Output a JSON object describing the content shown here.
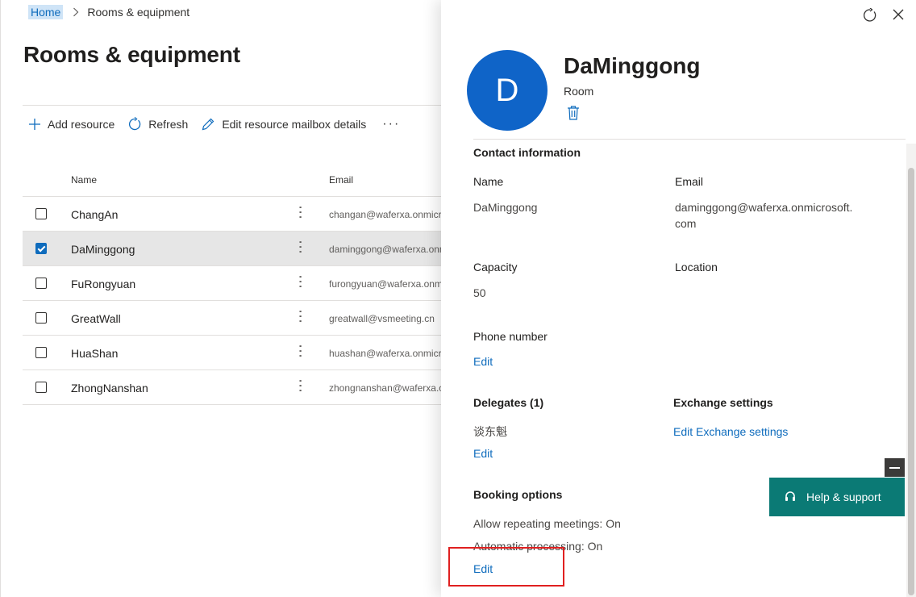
{
  "breadcrumb": {
    "home": "Home",
    "current": "Rooms & equipment"
  },
  "page": {
    "title": "Rooms & equipment"
  },
  "toolbar": {
    "add_label": "Add resource",
    "refresh_label": "Refresh",
    "edit_label": "Edit resource mailbox details",
    "more_label": "···"
  },
  "table": {
    "columns": {
      "name": "Name",
      "email": "Email"
    },
    "rows": [
      {
        "name": "ChangAn",
        "email": "changan@waferxa.onmicrosoft.com",
        "selected": false
      },
      {
        "name": "DaMinggong",
        "email": "daminggong@waferxa.onmicrosoft.com",
        "selected": true
      },
      {
        "name": "FuRongyuan",
        "email": "furongyuan@waferxa.onmicrosoft.com",
        "selected": false
      },
      {
        "name": "GreatWall",
        "email": "greatwall@vsmeeting.cn",
        "selected": false
      },
      {
        "name": "HuaShan",
        "email": "huashan@waferxa.onmicrosoft.com",
        "selected": false
      },
      {
        "name": "ZhongNanshan",
        "email": "zhongnanshan@waferxa.onmicrosoft.com",
        "selected": false
      }
    ]
  },
  "panel": {
    "avatar_letter": "D",
    "name": "DaMinggong",
    "type": "Room",
    "contact_title": "Contact information",
    "name_label": "Name",
    "name_value": "DaMinggong",
    "email_label": "Email",
    "email_value_line1": "daminggong@waferxa.onmicrosoft.",
    "email_value_line2": "com",
    "capacity_label": "Capacity",
    "capacity_value": "50",
    "location_label": "Location",
    "phone_label": "Phone number",
    "phone_edit": "Edit",
    "delegates_label": "Delegates (1)",
    "delegate_value": "谈东魁",
    "delegates_edit": "Edit",
    "exchange_label": "Exchange settings",
    "exchange_link": "Edit Exchange settings",
    "booking_label": "Booking options",
    "booking_line1": "Allow repeating meetings: On",
    "booking_line2": "Automatic processing: On",
    "booking_edit": "Edit"
  },
  "help": {
    "label": "Help & support"
  },
  "colors": {
    "accent": "#0f6cbd",
    "avatar": "#0f64c8",
    "help": "#0b7a75",
    "highlight": "#e02020"
  }
}
